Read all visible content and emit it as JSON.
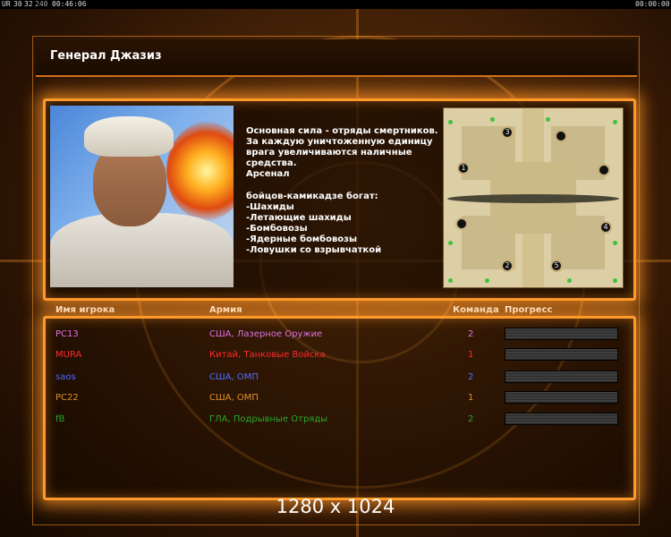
{
  "topbar": {
    "fps_label": "UR",
    "fps_values": [
      "30",
      "32",
      "240"
    ],
    "elapsed_time": "00:46:06",
    "right_time": "00:00:00"
  },
  "title": "Генерал Джазиз",
  "description": "Основная сила - отряды смертников.\nЗа каждую уничтоженную единицу\n врага увеличиваются наличные\nсредства.\nАрсенал\n\nбойцов-камикадзе богат:\n-Шахиды\n-Летающие шахиды\n-Бомбовозы\n-Ядерные бомбовозы\n-Ловушки со взрывчаткой",
  "map": {
    "start_positions": [
      "1",
      "2",
      "3",
      "4",
      "5"
    ]
  },
  "table": {
    "headers": {
      "name": "Имя игрока",
      "army": "Армия",
      "team": "Команда",
      "progress": "Прогресс"
    },
    "rows": [
      {
        "name": "PC13",
        "army": "США, Лазерное Оружие",
        "team": "2",
        "progress": 1.0,
        "color": "#e070e0"
      },
      {
        "name": "MURA",
        "army": "Китай, Танковые Войска",
        "team": "1",
        "progress": 1.0,
        "color": "#ff2a2a"
      },
      {
        "name": "saos",
        "army": "США, ОМП",
        "team": "2",
        "progress": 1.0,
        "color": "#4f6cff"
      },
      {
        "name": "PC22",
        "army": "США, ОМП",
        "team": "1",
        "progress": 1.0,
        "color": "#e0902a"
      },
      {
        "name": "fB",
        "army": "ГЛА, Подрывные Отряды",
        "team": "2",
        "progress": 1.0,
        "color": "#2aa82a"
      }
    ]
  },
  "resolution": "1280 x 1024",
  "colors": {
    "accent": "#ff9a2a",
    "background": "#4a2508"
  }
}
